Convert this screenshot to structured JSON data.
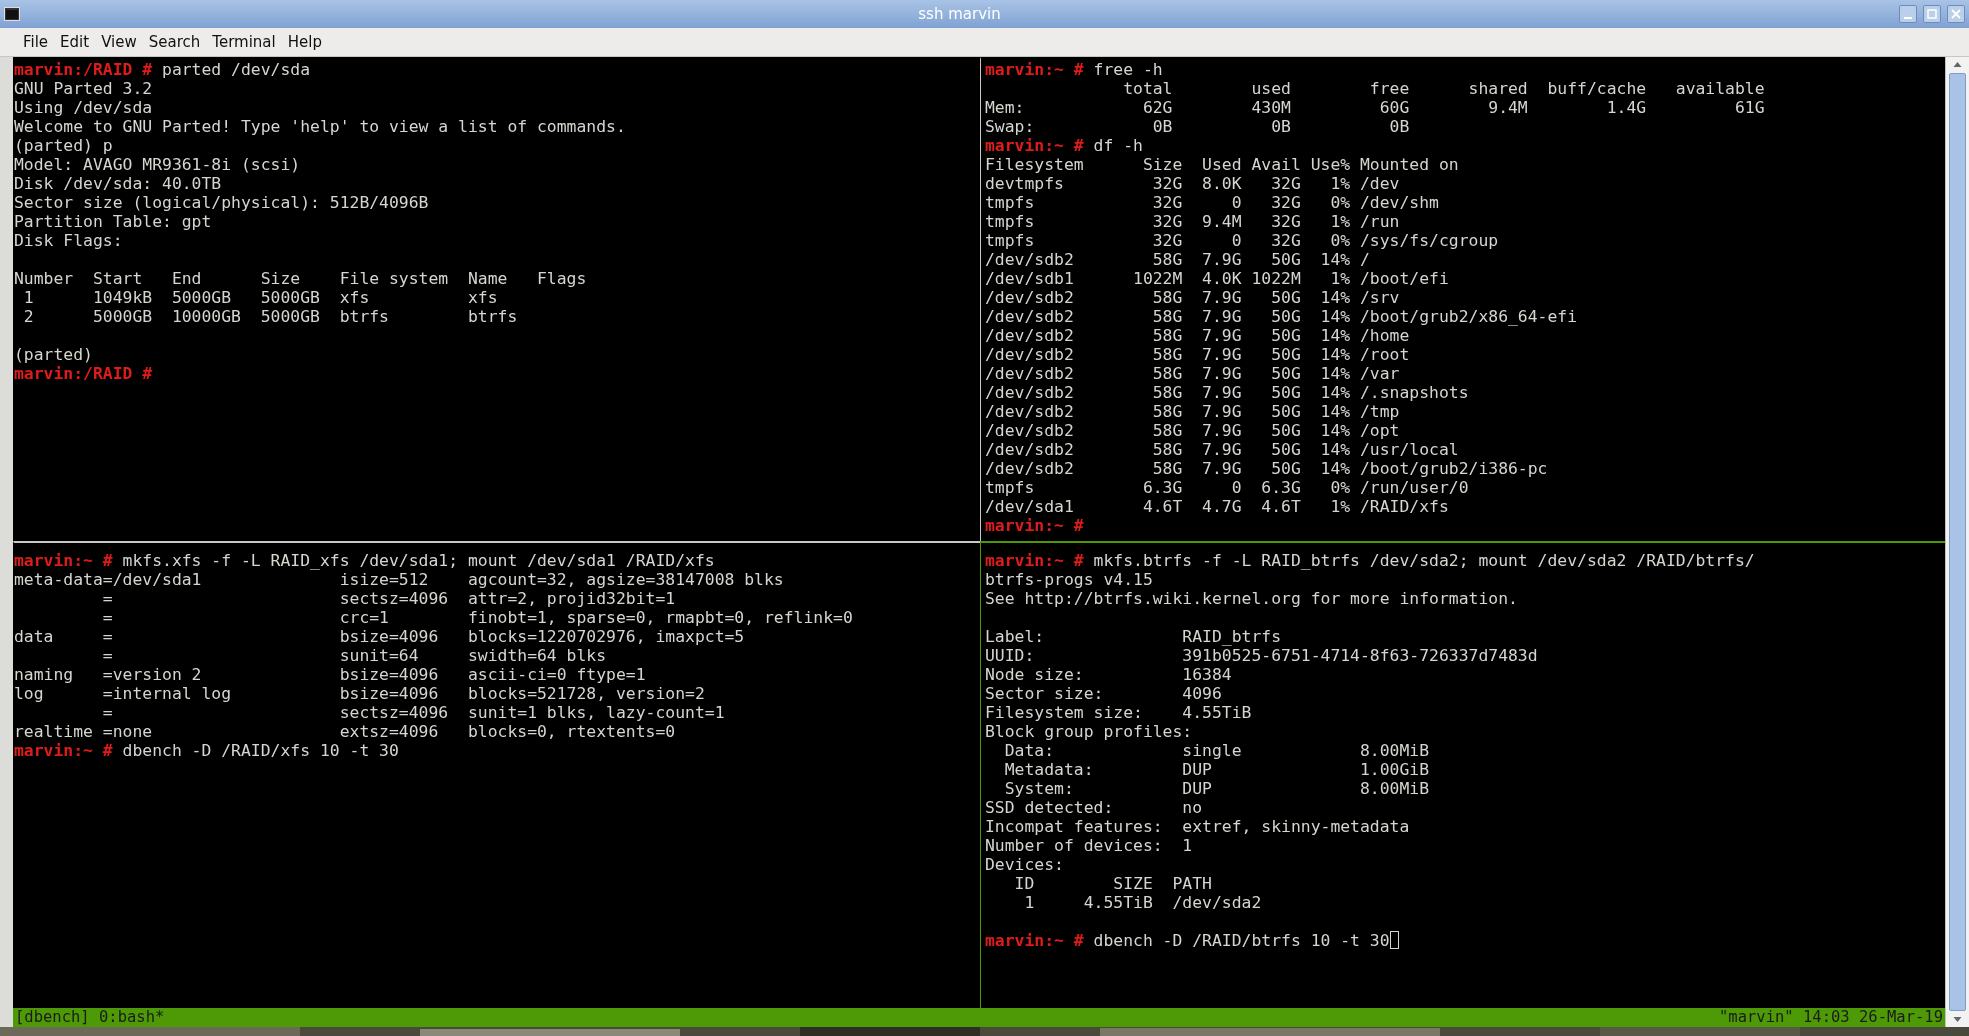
{
  "window": {
    "title": "ssh marvin"
  },
  "menu": [
    {
      "label": "File"
    },
    {
      "label": "Edit"
    },
    {
      "label": "View"
    },
    {
      "label": "Search"
    },
    {
      "label": "Terminal"
    },
    {
      "label": "Help"
    }
  ],
  "panes": [
    {
      "active": false,
      "lines": [
        {
          "kind": "prompt",
          "prompt": "marvin:/RAID #",
          "text": "parted /dev/sda"
        },
        {
          "kind": "output",
          "text": "GNU Parted 3.2"
        },
        {
          "kind": "output",
          "text": "Using /dev/sda"
        },
        {
          "kind": "output",
          "text": "Welcome to GNU Parted! Type 'help' to view a list of commands."
        },
        {
          "kind": "output",
          "text": "(parted) p"
        },
        {
          "kind": "output",
          "text": "Model: AVAGO MR9361-8i (scsi)"
        },
        {
          "kind": "output",
          "text": "Disk /dev/sda: 40.0TB"
        },
        {
          "kind": "output",
          "text": "Sector size (logical/physical): 512B/4096B"
        },
        {
          "kind": "output",
          "text": "Partition Table: gpt"
        },
        {
          "kind": "output",
          "text": "Disk Flags:"
        },
        {
          "kind": "blank"
        },
        {
          "kind": "output",
          "text": "Number  Start   End      Size    File system  Name   Flags"
        },
        {
          "kind": "output",
          "text": " 1      1049kB  5000GB   5000GB  xfs          xfs"
        },
        {
          "kind": "output",
          "text": " 2      5000GB  10000GB  5000GB  btrfs        btrfs"
        },
        {
          "kind": "blank"
        },
        {
          "kind": "output",
          "text": "(parted)"
        },
        {
          "kind": "prompt",
          "prompt": "marvin:/RAID #"
        }
      ]
    },
    {
      "active": false,
      "lines": [
        {
          "kind": "prompt",
          "prompt": "marvin:~ #",
          "text": "free -h"
        },
        {
          "kind": "output",
          "text": "              total        used        free      shared  buff/cache   available"
        },
        {
          "kind": "output",
          "text": "Mem:            62G        430M         60G        9.4M        1.4G         61G"
        },
        {
          "kind": "output",
          "text": "Swap:            0B          0B          0B"
        },
        {
          "kind": "prompt",
          "prompt": "marvin:~ #",
          "text": "df -h"
        },
        {
          "kind": "output",
          "text": "Filesystem      Size  Used Avail Use% Mounted on"
        },
        {
          "kind": "output",
          "text": "devtmpfs         32G  8.0K   32G   1% /dev"
        },
        {
          "kind": "output",
          "text": "tmpfs            32G     0   32G   0% /dev/shm"
        },
        {
          "kind": "output",
          "text": "tmpfs            32G  9.4M   32G   1% /run"
        },
        {
          "kind": "output",
          "text": "tmpfs            32G     0   32G   0% /sys/fs/cgroup"
        },
        {
          "kind": "output",
          "text": "/dev/sdb2        58G  7.9G   50G  14% /"
        },
        {
          "kind": "output",
          "text": "/dev/sdb1      1022M  4.0K 1022M   1% /boot/efi"
        },
        {
          "kind": "output",
          "text": "/dev/sdb2        58G  7.9G   50G  14% /srv"
        },
        {
          "kind": "output",
          "text": "/dev/sdb2        58G  7.9G   50G  14% /boot/grub2/x86_64-efi"
        },
        {
          "kind": "output",
          "text": "/dev/sdb2        58G  7.9G   50G  14% /home"
        },
        {
          "kind": "output",
          "text": "/dev/sdb2        58G  7.9G   50G  14% /root"
        },
        {
          "kind": "output",
          "text": "/dev/sdb2        58G  7.9G   50G  14% /var"
        },
        {
          "kind": "output",
          "text": "/dev/sdb2        58G  7.9G   50G  14% /.snapshots"
        },
        {
          "kind": "output",
          "text": "/dev/sdb2        58G  7.9G   50G  14% /tmp"
        },
        {
          "kind": "output",
          "text": "/dev/sdb2        58G  7.9G   50G  14% /opt"
        },
        {
          "kind": "output",
          "text": "/dev/sdb2        58G  7.9G   50G  14% /usr/local"
        },
        {
          "kind": "output",
          "text": "/dev/sdb2        58G  7.9G   50G  14% /boot/grub2/i386-pc"
        },
        {
          "kind": "output",
          "text": "tmpfs           6.3G     0  6.3G   0% /run/user/0"
        },
        {
          "kind": "output",
          "text": "/dev/sda1       4.6T  4.7G  4.6T   1% /RAID/xfs"
        },
        {
          "kind": "prompt",
          "prompt": "marvin:~ #"
        }
      ]
    },
    {
      "active": false,
      "lines": [
        {
          "kind": "prompt",
          "prompt": "marvin:~ #",
          "text": "mkfs.xfs -f -L RAID_xfs /dev/sda1; mount /dev/sda1 /RAID/xfs"
        },
        {
          "kind": "output",
          "text": "meta-data=/dev/sda1              isize=512    agcount=32, agsize=38147008 blks"
        },
        {
          "kind": "output",
          "text": "         =                       sectsz=4096  attr=2, projid32bit=1"
        },
        {
          "kind": "output",
          "text": "         =                       crc=1        finobt=1, sparse=0, rmapbt=0, reflink=0"
        },
        {
          "kind": "output",
          "text": "data     =                       bsize=4096   blocks=1220702976, imaxpct=5"
        },
        {
          "kind": "output",
          "text": "         =                       sunit=64     swidth=64 blks"
        },
        {
          "kind": "output",
          "text": "naming   =version 2              bsize=4096   ascii-ci=0 ftype=1"
        },
        {
          "kind": "output",
          "text": "log      =internal log           bsize=4096   blocks=521728, version=2"
        },
        {
          "kind": "output",
          "text": "         =                       sectsz=4096  sunit=1 blks, lazy-count=1"
        },
        {
          "kind": "output",
          "text": "realtime =none                   extsz=4096   blocks=0, rtextents=0"
        },
        {
          "kind": "prompt",
          "prompt": "marvin:~ #",
          "text": "dbench -D /RAID/xfs 10 -t 30"
        }
      ]
    },
    {
      "active": true,
      "lines": [
        {
          "kind": "prompt",
          "prompt": "marvin:~ #",
          "text": "mkfs.btrfs -f -L RAID_btrfs /dev/sda2; mount /dev/sda2 /RAID/btrfs/"
        },
        {
          "kind": "output",
          "text": "btrfs-progs v4.15"
        },
        {
          "kind": "output",
          "text": "See http://btrfs.wiki.kernel.org for more information."
        },
        {
          "kind": "blank"
        },
        {
          "kind": "output",
          "text": "Label:              RAID_btrfs"
        },
        {
          "kind": "output",
          "text": "UUID:               391b0525-6751-4714-8f63-726337d7483d"
        },
        {
          "kind": "output",
          "text": "Node size:          16384"
        },
        {
          "kind": "output",
          "text": "Sector size:        4096"
        },
        {
          "kind": "output",
          "text": "Filesystem size:    4.55TiB"
        },
        {
          "kind": "output",
          "text": "Block group profiles:"
        },
        {
          "kind": "output",
          "text": "  Data:             single            8.00MiB"
        },
        {
          "kind": "output",
          "text": "  Metadata:         DUP               1.00GiB"
        },
        {
          "kind": "output",
          "text": "  System:           DUP               8.00MiB"
        },
        {
          "kind": "output",
          "text": "SSD detected:       no"
        },
        {
          "kind": "output",
          "text": "Incompat features:  extref, skinny-metadata"
        },
        {
          "kind": "output",
          "text": "Number of devices:  1"
        },
        {
          "kind": "output",
          "text": "Devices:"
        },
        {
          "kind": "output",
          "text": "   ID        SIZE  PATH"
        },
        {
          "kind": "output",
          "text": "    1     4.55TiB  /dev/sda2"
        },
        {
          "kind": "blank"
        },
        {
          "kind": "prompt",
          "prompt": "marvin:~ #",
          "text": "dbench -D /RAID/btrfs 10 -t 30",
          "cursor": true
        }
      ]
    }
  ],
  "status_bar": {
    "left": "[dbench] 0:bash*",
    "right": "\"marvin\" 14:03 26-Mar-19"
  }
}
